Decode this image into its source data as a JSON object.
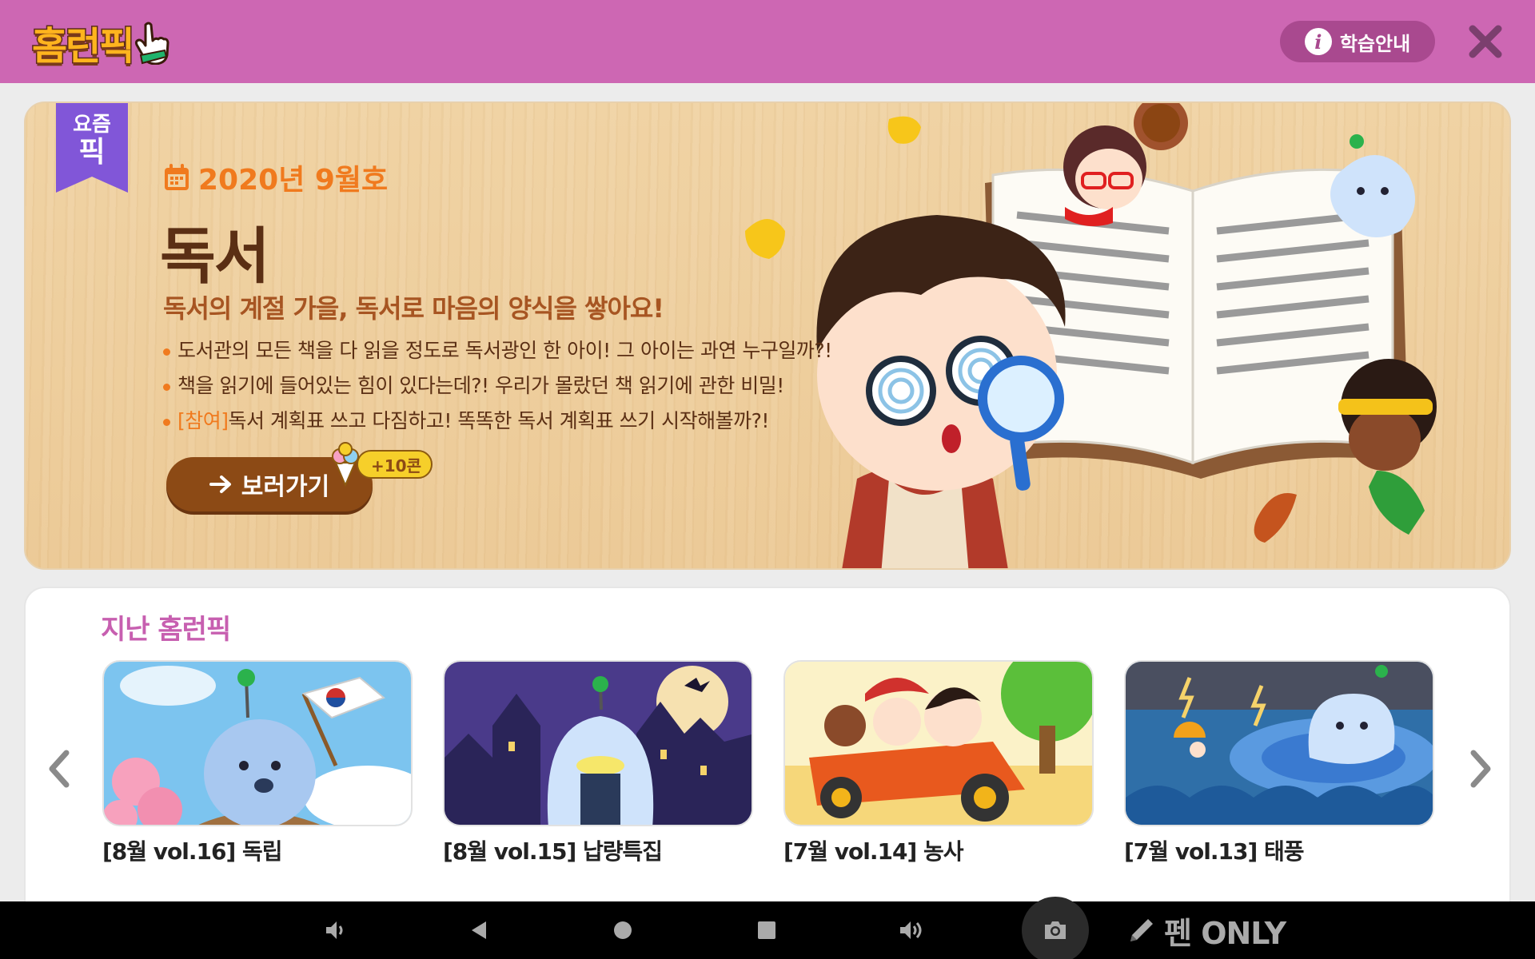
{
  "header": {
    "logo_text": "홈런픽",
    "guide_label": "학습안내",
    "colors": {
      "bar": "#cd67b3",
      "guide_button": "#a9498f"
    }
  },
  "hero": {
    "ribbon_small": "요즘",
    "ribbon_big": "픽",
    "issue": "2020년 9월호",
    "title": "독서",
    "subtitle": "독서의 계절 가을, 독서로 마음의 양식을 쌓아요!",
    "bullets": [
      {
        "tag": "",
        "text": "도서관의 모든 책을 다 읽을 정도로 독서광인 한 아이! 그 아이는 과연 누구일까?!"
      },
      {
        "tag": "",
        "text": "책을 읽기에 들어있는 힘이 있다는데?! 우리가 몰랐던 책 읽기에 관한 비밀!"
      },
      {
        "tag": "[참여]",
        "text": "독서 계획표 쓰고 다짐하고! 똑똑한 독서 계획표 쓰기 시작해볼까?!"
      }
    ],
    "go_button": "보러가기",
    "reward": "+10콘",
    "icons": [
      "calendar-icon",
      "arrow-right-icon",
      "ice-cream-icon"
    ]
  },
  "past": {
    "title": "지난 홈런픽",
    "cards": [
      {
        "label": "[8월 vol.16] 독립"
      },
      {
        "label": "[8월 vol.15] 납량특집"
      },
      {
        "label": "[7월 vol.14] 농사"
      },
      {
        "label": "[7월 vol.13] 태풍"
      }
    ]
  },
  "navbar": {
    "pen_label": "펜 ONLY",
    "icons": [
      "volume-down-icon",
      "back-icon",
      "home-icon",
      "recents-icon",
      "volume-up-icon",
      "camera-icon",
      "pencil-icon"
    ]
  }
}
